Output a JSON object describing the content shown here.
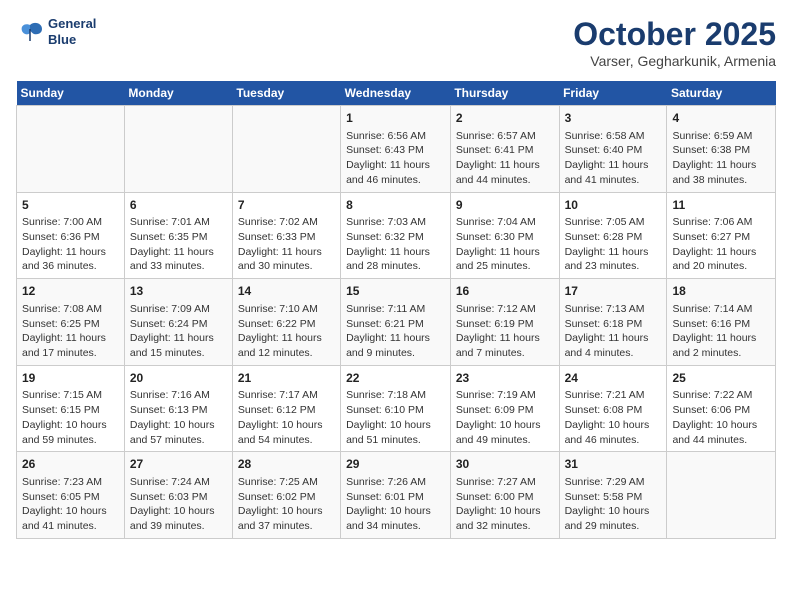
{
  "header": {
    "logo_line1": "General",
    "logo_line2": "Blue",
    "title": "October 2025",
    "subtitle": "Varser, Gegharkunik, Armenia"
  },
  "days_of_week": [
    "Sunday",
    "Monday",
    "Tuesday",
    "Wednesday",
    "Thursday",
    "Friday",
    "Saturday"
  ],
  "weeks": [
    [
      {
        "day": "",
        "content": ""
      },
      {
        "day": "",
        "content": ""
      },
      {
        "day": "",
        "content": ""
      },
      {
        "day": "1",
        "content": "Sunrise: 6:56 AM\nSunset: 6:43 PM\nDaylight: 11 hours and 46 minutes."
      },
      {
        "day": "2",
        "content": "Sunrise: 6:57 AM\nSunset: 6:41 PM\nDaylight: 11 hours and 44 minutes."
      },
      {
        "day": "3",
        "content": "Sunrise: 6:58 AM\nSunset: 6:40 PM\nDaylight: 11 hours and 41 minutes."
      },
      {
        "day": "4",
        "content": "Sunrise: 6:59 AM\nSunset: 6:38 PM\nDaylight: 11 hours and 38 minutes."
      }
    ],
    [
      {
        "day": "5",
        "content": "Sunrise: 7:00 AM\nSunset: 6:36 PM\nDaylight: 11 hours and 36 minutes."
      },
      {
        "day": "6",
        "content": "Sunrise: 7:01 AM\nSunset: 6:35 PM\nDaylight: 11 hours and 33 minutes."
      },
      {
        "day": "7",
        "content": "Sunrise: 7:02 AM\nSunset: 6:33 PM\nDaylight: 11 hours and 30 minutes."
      },
      {
        "day": "8",
        "content": "Sunrise: 7:03 AM\nSunset: 6:32 PM\nDaylight: 11 hours and 28 minutes."
      },
      {
        "day": "9",
        "content": "Sunrise: 7:04 AM\nSunset: 6:30 PM\nDaylight: 11 hours and 25 minutes."
      },
      {
        "day": "10",
        "content": "Sunrise: 7:05 AM\nSunset: 6:28 PM\nDaylight: 11 hours and 23 minutes."
      },
      {
        "day": "11",
        "content": "Sunrise: 7:06 AM\nSunset: 6:27 PM\nDaylight: 11 hours and 20 minutes."
      }
    ],
    [
      {
        "day": "12",
        "content": "Sunrise: 7:08 AM\nSunset: 6:25 PM\nDaylight: 11 hours and 17 minutes."
      },
      {
        "day": "13",
        "content": "Sunrise: 7:09 AM\nSunset: 6:24 PM\nDaylight: 11 hours and 15 minutes."
      },
      {
        "day": "14",
        "content": "Sunrise: 7:10 AM\nSunset: 6:22 PM\nDaylight: 11 hours and 12 minutes."
      },
      {
        "day": "15",
        "content": "Sunrise: 7:11 AM\nSunset: 6:21 PM\nDaylight: 11 hours and 9 minutes."
      },
      {
        "day": "16",
        "content": "Sunrise: 7:12 AM\nSunset: 6:19 PM\nDaylight: 11 hours and 7 minutes."
      },
      {
        "day": "17",
        "content": "Sunrise: 7:13 AM\nSunset: 6:18 PM\nDaylight: 11 hours and 4 minutes."
      },
      {
        "day": "18",
        "content": "Sunrise: 7:14 AM\nSunset: 6:16 PM\nDaylight: 11 hours and 2 minutes."
      }
    ],
    [
      {
        "day": "19",
        "content": "Sunrise: 7:15 AM\nSunset: 6:15 PM\nDaylight: 10 hours and 59 minutes."
      },
      {
        "day": "20",
        "content": "Sunrise: 7:16 AM\nSunset: 6:13 PM\nDaylight: 10 hours and 57 minutes."
      },
      {
        "day": "21",
        "content": "Sunrise: 7:17 AM\nSunset: 6:12 PM\nDaylight: 10 hours and 54 minutes."
      },
      {
        "day": "22",
        "content": "Sunrise: 7:18 AM\nSunset: 6:10 PM\nDaylight: 10 hours and 51 minutes."
      },
      {
        "day": "23",
        "content": "Sunrise: 7:19 AM\nSunset: 6:09 PM\nDaylight: 10 hours and 49 minutes."
      },
      {
        "day": "24",
        "content": "Sunrise: 7:21 AM\nSunset: 6:08 PM\nDaylight: 10 hours and 46 minutes."
      },
      {
        "day": "25",
        "content": "Sunrise: 7:22 AM\nSunset: 6:06 PM\nDaylight: 10 hours and 44 minutes."
      }
    ],
    [
      {
        "day": "26",
        "content": "Sunrise: 7:23 AM\nSunset: 6:05 PM\nDaylight: 10 hours and 41 minutes."
      },
      {
        "day": "27",
        "content": "Sunrise: 7:24 AM\nSunset: 6:03 PM\nDaylight: 10 hours and 39 minutes."
      },
      {
        "day": "28",
        "content": "Sunrise: 7:25 AM\nSunset: 6:02 PM\nDaylight: 10 hours and 37 minutes."
      },
      {
        "day": "29",
        "content": "Sunrise: 7:26 AM\nSunset: 6:01 PM\nDaylight: 10 hours and 34 minutes."
      },
      {
        "day": "30",
        "content": "Sunrise: 7:27 AM\nSunset: 6:00 PM\nDaylight: 10 hours and 32 minutes."
      },
      {
        "day": "31",
        "content": "Sunrise: 7:29 AM\nSunset: 5:58 PM\nDaylight: 10 hours and 29 minutes."
      },
      {
        "day": "",
        "content": ""
      }
    ]
  ]
}
